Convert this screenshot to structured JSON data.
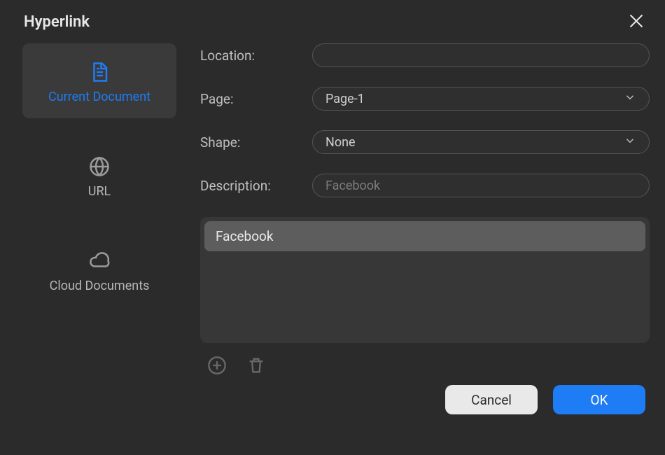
{
  "dialog": {
    "title": "Hyperlink"
  },
  "sidebar": {
    "items": [
      {
        "label": "Current Document"
      },
      {
        "label": "URL"
      },
      {
        "label": "Cloud Documents"
      }
    ]
  },
  "form": {
    "location": {
      "label": "Location:",
      "value": ""
    },
    "page": {
      "label": "Page:",
      "selected": "Page-1"
    },
    "shape": {
      "label": "Shape:",
      "selected": "None"
    },
    "description": {
      "label": "Description:",
      "value": "",
      "placeholder": "Facebook"
    }
  },
  "list": {
    "items": [
      {
        "label": "Facebook"
      }
    ]
  },
  "footer": {
    "cancel": "Cancel",
    "ok": "OK"
  }
}
